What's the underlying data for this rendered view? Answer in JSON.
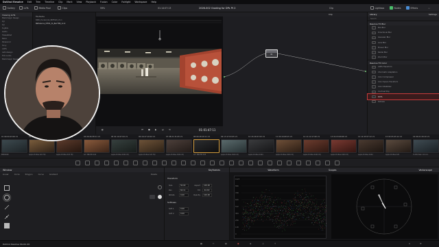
{
  "menubar": {
    "app": "DaVinci Resolve",
    "items": [
      "Edit",
      "Trim",
      "Timeline",
      "Clip",
      "Mark",
      "View",
      "Playback",
      "Fusion",
      "Color",
      "Fairlight",
      "Workspace",
      "Help"
    ],
    "right": ""
  },
  "toolbar": {
    "gallery": "Gallery",
    "luts": "LUTs",
    "media_pool": "Media Pool",
    "clips": "Clips",
    "project_title": "2026-002 Grading for DPs Pt 2",
    "zoom": "59%",
    "timecode_top": "01:14:07:13",
    "clip_label": "Clip",
    "lightbox": "Lightbox",
    "nodes": "Nodes",
    "effects": "Effects"
  },
  "left_panel": {
    "header": "Viewing LUTs",
    "items": [
      "Blackmagic Design",
      "DJI",
      "DJI",
      "Fujifilm",
      "GoPro",
      "Hasselblad",
      "Nikon",
      "Panasonic",
      "Sony",
      "ACES",
      "Astrodesign",
      "Film Looks",
      "Blackmagic Design"
    ]
  },
  "stills": {
    "header": "File Name",
    "items": [
      "BMD_Pocket_6k_BMFILM_V1.1",
      "Reference_CH01_to_Rec709_v1.4"
    ]
  },
  "viewer": {
    "timecode": "01:01:47:11"
  },
  "node_editor": {
    "header": "Clip",
    "node_label": "01"
  },
  "library": {
    "tab_library": "Library",
    "tab_settings": "Settings",
    "search": "Search",
    "cat_blur": "Resolve FX Blur",
    "blur_items": [
      "Box Blur",
      "Directional Blur",
      "Gaussian Blur",
      "Lens Blur",
      "Mosaic Blur",
      "Radial Blur",
      "Zoom Blur"
    ],
    "cat_color": "Resolve FX Color",
    "color_items": [
      "ACES Transform",
      "Chromatic Adaptation",
      "Color Compressor",
      "Color Space Transform",
      "Color Stabilizer",
      "Contrast Pop",
      "DCTL",
      "Dehaze"
    ]
  },
  "clips": {
    "items": [
      {
        "num": "01",
        "tc": "00:09:43:09",
        "lbl": "V1",
        "name": "EBD0000"
      },
      {
        "num": "02",
        "tc": "00:09:52:11",
        "lbl": "V1",
        "name": "Apple ProRes 422 HQ"
      },
      {
        "num": "03",
        "tc": "00:51:06:11",
        "lbl": "V1",
        "name": "Apple ProRes 422 HQ"
      },
      {
        "num": "04",
        "tc": "00:46:38:11",
        "lbl": "V1",
        "name": "Arri DNxHR 444"
      },
      {
        "num": "05",
        "tc": "01:19:47:04",
        "lbl": "V1",
        "name": "Apple ProRes 4444 XQ"
      },
      {
        "num": "06",
        "tc": "16:47:10:04",
        "lbl": "V1",
        "name": "Apple ProRes 422 HQ"
      },
      {
        "num": "07",
        "tc": "08:21:31:05",
        "lbl": "V1",
        "name": "Apple ProRes 4444 XQ"
      },
      {
        "num": "08",
        "tc": "00:48:18:11",
        "lbl": "V1",
        "name": "Arri DNxHR 444"
      },
      {
        "num": "09",
        "tc": "17:47:03:05",
        "lbl": "V1",
        "name": "Apple ProRes 4444 XQ"
      },
      {
        "num": "10",
        "tc": "15:26:57:03",
        "lbl": "V1",
        "name": "Apple ProRes 4444"
      },
      {
        "num": "11",
        "tc": "02:44:08:15",
        "lbl": "V1",
        "name": "Apple ProRes 4444 XQ"
      },
      {
        "num": "12",
        "tc": "11:12:17:00",
        "lbl": "V1",
        "name": "Apple ProRes 4444 XQ"
      },
      {
        "num": "13",
        "tc": "01:03:08:08",
        "lbl": "V1",
        "name": "Apple ProRes 4444 XQ"
      },
      {
        "num": "14",
        "tc": "12:45:57:12",
        "lbl": "V1",
        "name": "Apple ProRes 4444"
      },
      {
        "num": "15",
        "tc": "02:05:45:12",
        "lbl": "V1",
        "name": "Apple ProRes 422"
      },
      {
        "num": "16",
        "tc": "00:21:29:10",
        "lbl": "V1",
        "name": "H.265 Main 10 L5.1"
      }
    ]
  },
  "window_panel": {
    "header": "Window",
    "tools": [
      "Linear",
      "Circle",
      "Polygon",
      "Curve",
      "Gradient"
    ],
    "delete": "Delete"
  },
  "transform": {
    "header": "Transform",
    "keyframes": "Keyframes",
    "rows": [
      {
        "l": "Size",
        "v": "50.00",
        "l2": "Aspect",
        "v2": "100.00"
      },
      {
        "l": "Pan",
        "v": "64.11",
        "l2": "Tilt",
        "v2": "-61.60"
      },
      {
        "l": "Rotate",
        "v": "0.00",
        "l2": "Opacity",
        "v2": "100.00"
      }
    ],
    "softness": "Softness",
    "soft_rows": [
      {
        "l": "Soft 1",
        "v": "0.00"
      },
      {
        "l": "Soft 2",
        "v": "0.00"
      }
    ]
  },
  "scopes": {
    "header": "Scopes",
    "waveform": "Waveform",
    "vectorscope": "Vectorscope",
    "labels": [
      "1023",
      "896",
      "768",
      "640",
      "512",
      "384",
      "256",
      "128",
      "0"
    ]
  },
  "pagebar": {
    "app": "DaVinci Resolve Studio 20"
  }
}
